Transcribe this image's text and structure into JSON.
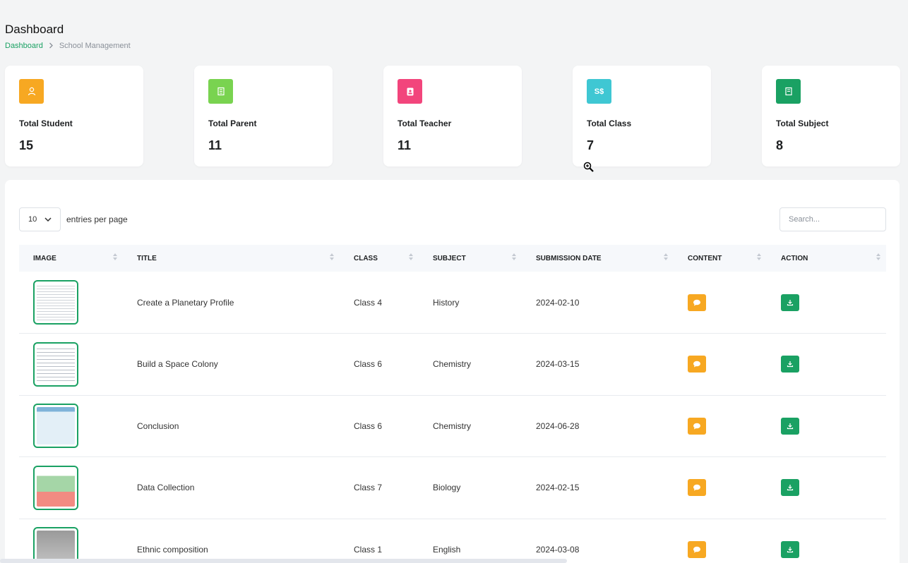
{
  "page": {
    "title": "Dashboard",
    "breadcrumb": {
      "link": "Dashboard",
      "current": "School Management"
    }
  },
  "stats": [
    {
      "label": "Total Student",
      "value": "15",
      "icon": "user-icon",
      "color": "#f7a822"
    },
    {
      "label": "Total Parent",
      "value": "11",
      "icon": "building-icon",
      "color": "#79d350"
    },
    {
      "label": "Total Teacher",
      "value": "11",
      "icon": "id-badge-icon",
      "color": "#f2457c"
    },
    {
      "label": "Total Class",
      "value": "7",
      "icon": "currency-icon",
      "icon_text": "S$",
      "color": "#3fc7d3"
    },
    {
      "label": "Total Subject",
      "value": "8",
      "icon": "book-icon",
      "color": "#1aa163"
    }
  ],
  "table_controls": {
    "entries_value": "10",
    "entries_label": "entries per page",
    "search_placeholder": "Search..."
  },
  "table": {
    "columns": [
      "IMAGE",
      "TITLE",
      "CLASS",
      "SUBJECT",
      "SUBMISSION DATE",
      "CONTENT",
      "ACTION"
    ],
    "rows": [
      {
        "title": "Create a Planetary Profile",
        "class": "Class 4",
        "subject": "History",
        "date": "2024-02-10"
      },
      {
        "title": "Build a Space Colony",
        "class": "Class 6",
        "subject": "Chemistry",
        "date": "2024-03-15"
      },
      {
        "title": "Conclusion",
        "class": "Class 6",
        "subject": "Chemistry",
        "date": "2024-06-28"
      },
      {
        "title": "Data Collection",
        "class": "Class 7",
        "subject": "Biology",
        "date": "2024-02-15"
      },
      {
        "title": "Ethnic composition",
        "class": "Class 1",
        "subject": "English",
        "date": "2024-03-08"
      }
    ]
  },
  "colors": {
    "accent": "#1aa163",
    "content_button": "#f7a822"
  }
}
